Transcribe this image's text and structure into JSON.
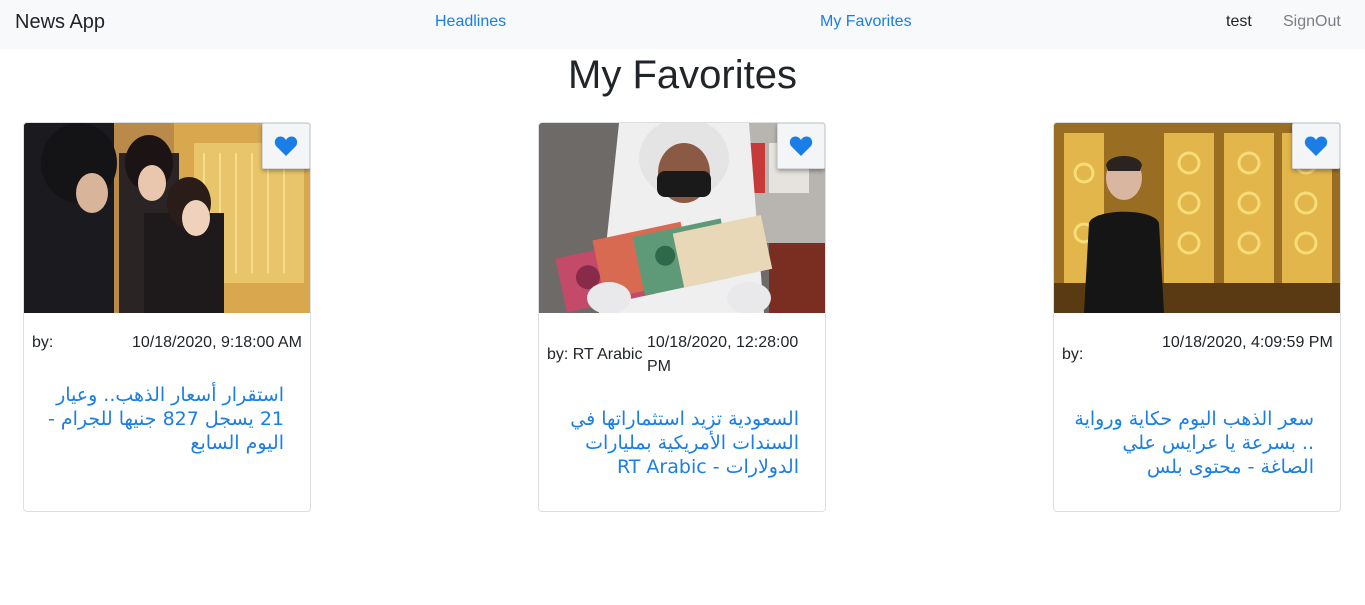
{
  "nav": {
    "brand": "News App",
    "headlines": "Headlines",
    "favorites": "My Favorites",
    "user": "test",
    "signout": "SignOut"
  },
  "page": {
    "title": "My Favorites"
  },
  "colors": {
    "accent": "#1a7ee6",
    "heart": "#1a7ee6"
  },
  "cards": [
    {
      "by": "by:",
      "date": "10/18/2020, 9:18:00 AM",
      "title": "استقرار أسعار الذهب.. وعيار 21 يسجل 827 جنيها للجرام - اليوم السابع",
      "icon": "heart-icon"
    },
    {
      "by": "by: RT Arabic",
      "date": "10/18/2020, 12:28:00 PM",
      "title": "السعودية تزيد استثماراتها في السندات الأمريكية بمليارات الدولارات - RT Arabic",
      "icon": "heart-icon"
    },
    {
      "by": "by:",
      "date": "10/18/2020, 4:09:59 PM",
      "title": "سعر الذهب اليوم حكاية ورواية .. بسرعة يا عرايس علي الصاغة - محتوى بلس",
      "icon": "heart-icon"
    }
  ]
}
